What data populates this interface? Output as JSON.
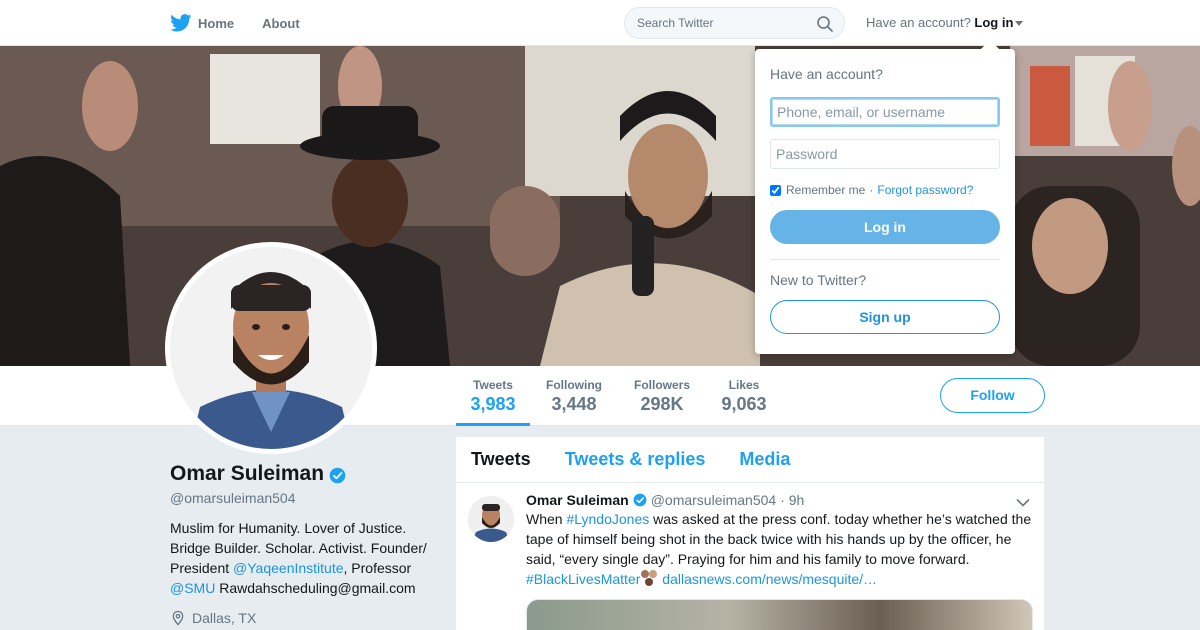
{
  "nav": {
    "home_label": "Home",
    "about_label": "About",
    "search_placeholder": "Search Twitter",
    "account_prompt": "Have an account?",
    "login_label": "Log in"
  },
  "profile": {
    "name": "Omar Suleiman",
    "handle": "@omarsuleiman504",
    "bio_part1": "Muslim for Humanity. Lover of Justice. Bridge Builder. Scholar. Activist. Founder/ President ",
    "bio_link1": "@YaqeenInstitute",
    "bio_part2": ", Professor ",
    "bio_link2": "@SMU",
    "bio_part3": " Rawdahscheduling@gmail.com",
    "location": "Dallas, TX"
  },
  "stats": [
    {
      "label": "Tweets",
      "value": "3,983"
    },
    {
      "label": "Following",
      "value": "3,448"
    },
    {
      "label": "Followers",
      "value": "298K"
    },
    {
      "label": "Likes",
      "value": "9,063"
    }
  ],
  "follow_label": "Follow",
  "timeline": {
    "tabs": [
      "Tweets",
      "Tweets & replies",
      "Media"
    ],
    "tweet": {
      "name": "Omar Suleiman",
      "handle": "@omarsuleiman504",
      "time": "· 9h",
      "text_part1": "When ",
      "hashtag1": "#LyndoJones",
      "text_part2": " was asked at the press conf. today whether he’s watched the tape of himself being shot in the back twice with his hands up by the officer, he said, “every single day”. Praying for him and his family to move forward.",
      "hashtag2": "#BlackLivesMatter",
      "link": "dallasnews.com/news/mesquite/…"
    }
  },
  "login_dropdown": {
    "title": "Have an account?",
    "username_placeholder": "Phone, email, or username",
    "password_placeholder": "Password",
    "remember_label": "Remember me",
    "separator": "·",
    "forgot_label": "Forgot password?",
    "login_button": "Log in",
    "new_prompt": "New to Twitter?",
    "signup_button": "Sign up"
  },
  "colors": {
    "brand": "#1da1f2",
    "link": "#1b95e0",
    "page_bg": "#e6ecf0"
  }
}
